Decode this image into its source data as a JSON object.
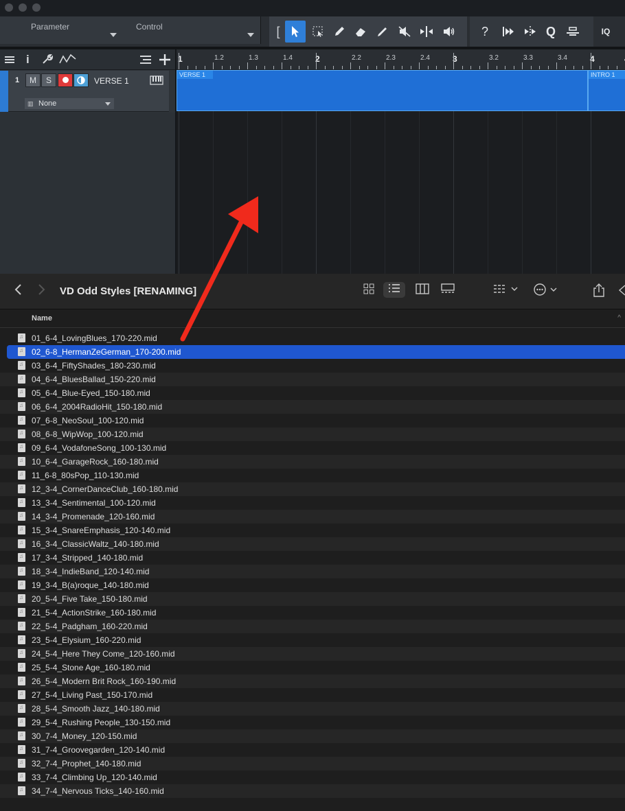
{
  "daw": {
    "parameter_label": "Parameter",
    "control_label": "Control",
    "track": {
      "number": "1",
      "mute_label": "M",
      "solo_label": "S",
      "name": "VERSE 1",
      "input_value": "None"
    },
    "ruler_labels": [
      "1",
      "1.2",
      "1.3",
      "1.4",
      "2",
      "2.2",
      "2.3",
      "2.4",
      "3",
      "3.2",
      "3.3",
      "3.4",
      "4",
      "4"
    ],
    "clips": [
      {
        "label": "VERSE 1"
      },
      {
        "label": "INTRO 1"
      }
    ],
    "tools": {
      "help": "?",
      "quantize": "Q",
      "iq": "IQ"
    }
  },
  "finder": {
    "title": "VD Odd Styles [RENAMING]",
    "column_name": "Name",
    "files": [
      {
        "name": "01_6-4_LovingBlues_170-220.mid",
        "selected": false
      },
      {
        "name": "02_6-8_HermanZeGerman_170-200.mid",
        "selected": true
      },
      {
        "name": "03_6-4_FiftyShades_180-230.mid",
        "selected": false
      },
      {
        "name": "04_6-4_BluesBallad_150-220.mid",
        "selected": false
      },
      {
        "name": "05_6-4_Blue-Eyed_150-180.mid",
        "selected": false
      },
      {
        "name": "06_6-4_2004RadioHit_150-180.mid",
        "selected": false
      },
      {
        "name": "07_6-8_NeoSoul_100-120.mid",
        "selected": false
      },
      {
        "name": "08_6-8_WipWop_100-120.mid",
        "selected": false
      },
      {
        "name": "09_6-4_VodafoneSong_100-130.mid",
        "selected": false
      },
      {
        "name": "10_6-4_GarageRock_160-180.mid",
        "selected": false
      },
      {
        "name": "11_6-8_80sPop_110-130.mid",
        "selected": false
      },
      {
        "name": "12_3-4_CornerDanceClub_160-180.mid",
        "selected": false
      },
      {
        "name": "13_3-4_Sentimental_100-120.mid",
        "selected": false
      },
      {
        "name": "14_3-4_Promenade_120-160.mid",
        "selected": false
      },
      {
        "name": "15_3-4_SnareEmphasis_120-140.mid",
        "selected": false
      },
      {
        "name": "16_3-4_ClassicWaltz_140-180.mid",
        "selected": false
      },
      {
        "name": "17_3-4_Stripped_140-180.mid",
        "selected": false
      },
      {
        "name": "18_3-4_IndieBand_120-140.mid",
        "selected": false
      },
      {
        "name": "19_3-4_B(a)roque_140-180.mid",
        "selected": false
      },
      {
        "name": "20_5-4_Five Take_150-180.mid",
        "selected": false
      },
      {
        "name": "21_5-4_ActionStrike_160-180.mid",
        "selected": false
      },
      {
        "name": "22_5-4_Padgham_160-220.mid",
        "selected": false
      },
      {
        "name": "23_5-4_Elysium_160-220.mid",
        "selected": false
      },
      {
        "name": "24_5-4_Here They Come_120-160.mid",
        "selected": false
      },
      {
        "name": "25_5-4_Stone Age_160-180.mid",
        "selected": false
      },
      {
        "name": "26_5-4_Modern Brit Rock_160-190.mid",
        "selected": false
      },
      {
        "name": "27_5-4_Living Past_150-170.mid",
        "selected": false
      },
      {
        "name": "28_5-4_Smooth Jazz_140-180.mid",
        "selected": false
      },
      {
        "name": "29_5-4_Rushing People_130-150.mid",
        "selected": false
      },
      {
        "name": "30_7-4_Money_120-150.mid",
        "selected": false
      },
      {
        "name": "31_7-4_Groovegarden_120-140.mid",
        "selected": false
      },
      {
        "name": "32_7-4_Prophet_140-180.mid",
        "selected": false
      },
      {
        "name": "33_7-4_Climbing Up_120-140.mid",
        "selected": false
      },
      {
        "name": "34_7-4_Nervous Ticks_140-160.mid",
        "selected": false
      }
    ]
  },
  "colors": {
    "selection": "#1f57d0",
    "clip": "#1f6fd6",
    "active_tool": "#2f7fd8",
    "annotation_arrow": "#f02a1c"
  },
  "icons": {
    "tools": [
      "bracket-icon",
      "arrow-tool-icon",
      "range-tool-icon",
      "pencil-icon",
      "eraser-icon",
      "paint-icon",
      "mute-tool-icon",
      "split-icon",
      "listen-icon",
      "help-icon",
      "transient-icon",
      "bend-icon",
      "quantize-icon",
      "audio-bend-icon"
    ],
    "finder": [
      "back-icon",
      "forward-icon",
      "icon-view-icon",
      "list-view-icon",
      "column-view-icon",
      "gallery-view-icon",
      "group-icon",
      "action-icon",
      "share-icon"
    ]
  }
}
